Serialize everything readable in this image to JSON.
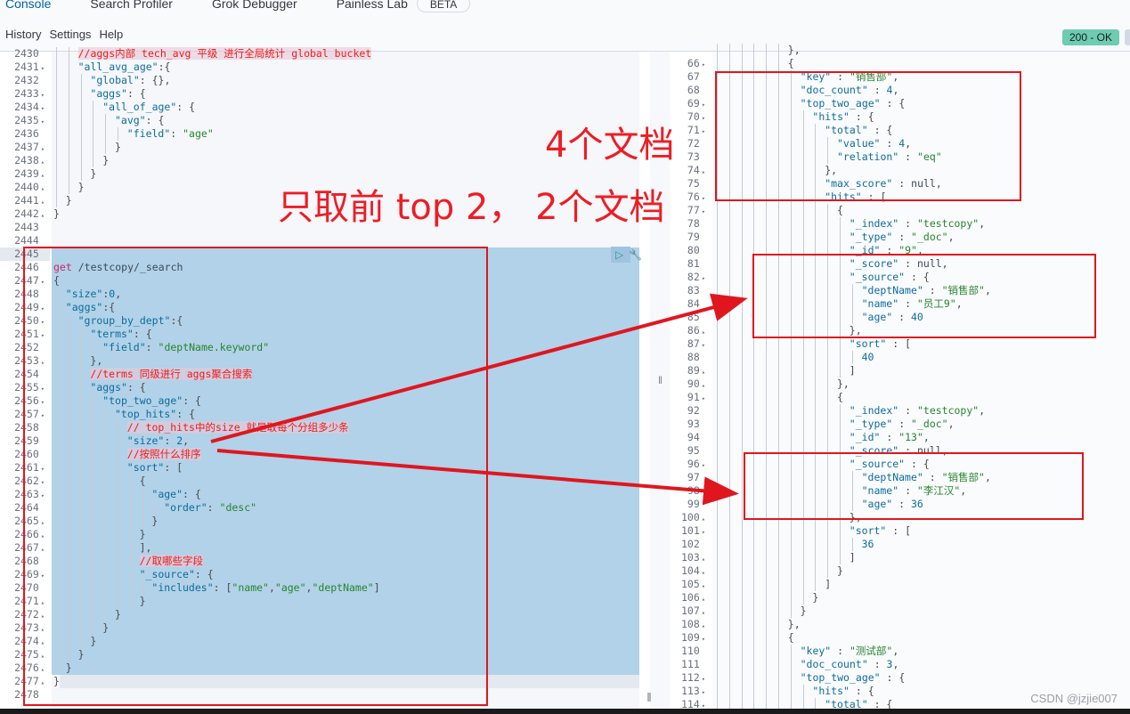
{
  "tabs": [
    {
      "label": "Console",
      "active": true
    },
    {
      "label": "Search Profiler",
      "active": false
    },
    {
      "label": "Grok Debugger",
      "active": false
    },
    {
      "label": "Painless Lab",
      "active": false
    }
  ],
  "tabs_badge": "BETA",
  "menu": {
    "history": "History",
    "settings": "Settings",
    "help": "Help"
  },
  "status": {
    "label": "200 - OK",
    "color": "#6dccb1"
  },
  "request_editor": {
    "lines": [
      {
        "n": "2430",
        "fold": "",
        "indent": 2,
        "html": "<span class='c'>//aggs内部 tech_avg 平级 进行全局统计 global bucket</span>"
      },
      {
        "n": "2431",
        "fold": "▾",
        "indent": 2,
        "html": "<span class='k'>\"all_avg_age\"</span><span class='p'>:{</span>"
      },
      {
        "n": "2432",
        "fold": "",
        "indent": 3,
        "html": "<span class='k'>\"global\"</span><span class='p'>: {},</span>"
      },
      {
        "n": "2433",
        "fold": "▾",
        "indent": 3,
        "html": "<span class='k'>\"aggs\"</span><span class='p'>: {</span>"
      },
      {
        "n": "2434",
        "fold": "▾",
        "indent": 4,
        "html": "<span class='k'>\"all_of_age\"</span><span class='p'>: {</span>"
      },
      {
        "n": "2435",
        "fold": "▾",
        "indent": 5,
        "html": "<span class='k'>\"avg\"</span><span class='p'>: {</span>"
      },
      {
        "n": "2436",
        "fold": "",
        "indent": 6,
        "html": "<span class='k'>\"field\"</span><span class='p'>: </span><span class='s'>\"age\"</span>"
      },
      {
        "n": "2437",
        "fold": "▴",
        "indent": 5,
        "html": "<span class='p'>}</span>"
      },
      {
        "n": "2438",
        "fold": "▴",
        "indent": 4,
        "html": "<span class='p'>}</span>"
      },
      {
        "n": "2439",
        "fold": "▴",
        "indent": 3,
        "html": "<span class='p'>}</span>"
      },
      {
        "n": "2440",
        "fold": "▴",
        "indent": 2,
        "html": "<span class='p'>}</span>"
      },
      {
        "n": "2441",
        "fold": "▴",
        "indent": 1,
        "html": "<span class='p'>}</span>"
      },
      {
        "n": "2442",
        "fold": "▴",
        "indent": 0,
        "html": "<span class='p'>}</span>"
      },
      {
        "n": "2443",
        "fold": "",
        "indent": 0,
        "html": ""
      },
      {
        "n": "2444",
        "fold": "",
        "indent": 0,
        "html": ""
      },
      {
        "n": "2445",
        "fold": "",
        "indent": 0,
        "html": ""
      },
      {
        "n": "2446",
        "fold": "",
        "indent": 0,
        "html": "<span class='kw'>get</span> <span class='url'>/testcopy/_search</span>"
      },
      {
        "n": "2447",
        "fold": "▾",
        "indent": 0,
        "html": "<span class='p'>{</span>"
      },
      {
        "n": "2448",
        "fold": "",
        "indent": 1,
        "html": "<span class='k'>\"size\"</span><span class='p'>:</span><span class='n'>0</span><span class='p'>,</span>"
      },
      {
        "n": "2449",
        "fold": "▾",
        "indent": 1,
        "html": "<span class='k'>\"aggs\"</span><span class='p'>:{</span>"
      },
      {
        "n": "2450",
        "fold": "▾",
        "indent": 2,
        "html": "<span class='k'>\"group_by_dept\"</span><span class='p'>:{</span>"
      },
      {
        "n": "2451",
        "fold": "▾",
        "indent": 3,
        "html": "<span class='k'>\"terms\"</span><span class='p'>: {</span>"
      },
      {
        "n": "2452",
        "fold": "",
        "indent": 4,
        "html": "<span class='k'>\"field\"</span><span class='p'>: </span><span class='s'>\"deptName.keyword\"</span>"
      },
      {
        "n": "2453",
        "fold": "▴",
        "indent": 3,
        "html": "<span class='p'>},</span>"
      },
      {
        "n": "2454",
        "fold": "",
        "indent": 3,
        "html": "<span class='c'>//terms 同级进行 aggs聚合搜索</span>"
      },
      {
        "n": "2455",
        "fold": "▾",
        "indent": 3,
        "html": "<span class='k'>\"aggs\"</span><span class='p'>: {</span>"
      },
      {
        "n": "2456",
        "fold": "▾",
        "indent": 4,
        "html": "<span class='k'>\"top_two_age\"</span><span class='p'>: {</span>"
      },
      {
        "n": "2457",
        "fold": "▾",
        "indent": 5,
        "html": "<span class='k'>\"top_hits\"</span><span class='p'>: {</span>"
      },
      {
        "n": "2458",
        "fold": "",
        "indent": 6,
        "html": "<span class='c'>// top_hits中的size 就是取每个分组多少条</span>"
      },
      {
        "n": "2459",
        "fold": "",
        "indent": 6,
        "html": "<span class='k'>\"size\"</span><span class='p'>: </span><span class='n'>2</span><span class='p'>,</span>"
      },
      {
        "n": "2460",
        "fold": "",
        "indent": 6,
        "html": "<span class='c'>//按照什么排序</span>"
      },
      {
        "n": "2461",
        "fold": "▾",
        "indent": 6,
        "html": "<span class='k'>\"sort\"</span><span class='p'>: [</span>"
      },
      {
        "n": "2462",
        "fold": "▾",
        "indent": 7,
        "html": "<span class='p'>{</span>"
      },
      {
        "n": "2463",
        "fold": "▾",
        "indent": 8,
        "html": "<span class='k'>\"age\"</span><span class='p'>: {</span>"
      },
      {
        "n": "2464",
        "fold": "",
        "indent": 9,
        "html": "<span class='k'>\"order\"</span><span class='p'>: </span><span class='s'>\"desc\"</span>"
      },
      {
        "n": "2465",
        "fold": "▴",
        "indent": 8,
        "html": "<span class='p'>}</span>"
      },
      {
        "n": "2466",
        "fold": "▴",
        "indent": 7,
        "html": "<span class='p'>}</span>"
      },
      {
        "n": "2467",
        "fold": "▴",
        "indent": 7,
        "html": "<span class='p'>],</span>"
      },
      {
        "n": "2468",
        "fold": "",
        "indent": 7,
        "html": "<span class='c'>//取哪些字段</span>"
      },
      {
        "n": "2469",
        "fold": "▾",
        "indent": 7,
        "html": "<span class='k'>\"_source\"</span><span class='p'>: {</span>"
      },
      {
        "n": "2470",
        "fold": "",
        "indent": 8,
        "html": "<span class='k'>\"includes\"</span><span class='p'>: [</span><span class='s'>\"name\"</span><span class='p'>,</span><span class='s'>\"age\"</span><span class='p'>,</span><span class='s'>\"deptName\"</span><span class='p'>]</span>"
      },
      {
        "n": "2471",
        "fold": "▴",
        "indent": 7,
        "html": "<span class='p'>}</span>"
      },
      {
        "n": "2472",
        "fold": "▴",
        "indent": 5,
        "html": "<span class='p'>}</span>"
      },
      {
        "n": "2473",
        "fold": "▴",
        "indent": 4,
        "html": "<span class='p'>}</span>"
      },
      {
        "n": "2474",
        "fold": "▴",
        "indent": 3,
        "html": "<span class='p'>}</span>"
      },
      {
        "n": "2475",
        "fold": "▴",
        "indent": 2,
        "html": "<span class='p'>}</span>"
      },
      {
        "n": "2476",
        "fold": "▴",
        "indent": 1,
        "html": "<span class='p'>}</span>"
      },
      {
        "n": "2477",
        "fold": "▴",
        "indent": 0,
        "html": "<span class='p'>}</span>"
      },
      {
        "n": "2478",
        "fold": "",
        "indent": 0,
        "html": ""
      }
    ]
  },
  "response_editor": {
    "lines": [
      {
        "n": "",
        "fold": "",
        "indent": 6,
        "html": "<span class='p'>},</span>"
      },
      {
        "n": "66",
        "fold": "▾",
        "indent": 6,
        "html": "<span class='p'>{</span>"
      },
      {
        "n": "67",
        "fold": "",
        "indent": 7,
        "html": "<span class='k'>\"key\"</span><span class='p'> : </span><span class='s'>\"销售部\"</span><span class='p'>,</span>"
      },
      {
        "n": "68",
        "fold": "",
        "indent": 7,
        "html": "<span class='k'>\"doc_count\"</span><span class='p'> : </span><span class='n'>4</span><span class='p'>,</span>"
      },
      {
        "n": "69",
        "fold": "▾",
        "indent": 7,
        "html": "<span class='k'>\"top_two_age\"</span><span class='p'> : {</span>"
      },
      {
        "n": "70",
        "fold": "▾",
        "indent": 8,
        "html": "<span class='k'>\"hits\"</span><span class='p'> : {</span>"
      },
      {
        "n": "71",
        "fold": "▾",
        "indent": 9,
        "html": "<span class='k'>\"total\"</span><span class='p'> : {</span>"
      },
      {
        "n": "72",
        "fold": "",
        "indent": 10,
        "html": "<span class='k'>\"value\"</span><span class='p'> : </span><span class='n'>4</span><span class='p'>,</span>"
      },
      {
        "n": "73",
        "fold": "",
        "indent": 10,
        "html": "<span class='k'>\"relation\"</span><span class='p'> : </span><span class='s'>\"eq\"</span>"
      },
      {
        "n": "74",
        "fold": "▴",
        "indent": 9,
        "html": "<span class='p'>},</span>"
      },
      {
        "n": "75",
        "fold": "",
        "indent": 9,
        "html": "<span class='k'>\"max_score\"</span><span class='p'> : </span><span class='nul'>null</span><span class='p'>,</span>"
      },
      {
        "n": "76",
        "fold": "▾",
        "indent": 9,
        "html": "<span class='k'>\"hits\"</span><span class='p'> : [</span>"
      },
      {
        "n": "77",
        "fold": "▾",
        "indent": 10,
        "html": "<span class='p'>{</span>"
      },
      {
        "n": "78",
        "fold": "",
        "indent": 11,
        "html": "<span class='k'>\"_index\"</span><span class='p'> : </span><span class='s'>\"testcopy\"</span><span class='p'>,</span>"
      },
      {
        "n": "79",
        "fold": "",
        "indent": 11,
        "html": "<span class='k'>\"_type\"</span><span class='p'> : </span><span class='s'>\"_doc\"</span><span class='p'>,</span>"
      },
      {
        "n": "80",
        "fold": "",
        "indent": 11,
        "html": "<span class='k'>\"_id\"</span><span class='p'> : </span><span class='s'>\"9\"</span><span class='p'>,</span>"
      },
      {
        "n": "81",
        "fold": "",
        "indent": 11,
        "html": "<span class='k'>\"_score\"</span><span class='p'> : </span><span class='nul'>null</span><span class='p'>,</span>"
      },
      {
        "n": "82",
        "fold": "▾",
        "indent": 11,
        "html": "<span class='k'>\"_source\"</span><span class='p'> : {</span>"
      },
      {
        "n": "83",
        "fold": "",
        "indent": 12,
        "html": "<span class='k'>\"deptName\"</span><span class='p'> : </span><span class='s'>\"销售部\"</span><span class='p'>,</span>"
      },
      {
        "n": "84",
        "fold": "",
        "indent": 12,
        "html": "<span class='k'>\"name\"</span><span class='p'> : </span><span class='s'>\"员工9\"</span><span class='p'>,</span>"
      },
      {
        "n": "85",
        "fold": "",
        "indent": 12,
        "html": "<span class='k'>\"age\"</span><span class='p'> : </span><span class='n'>40</span>"
      },
      {
        "n": "86",
        "fold": "▴",
        "indent": 11,
        "html": "<span class='p'>},</span>"
      },
      {
        "n": "87",
        "fold": "▾",
        "indent": 11,
        "html": "<span class='k'>\"sort\"</span><span class='p'> : [</span>"
      },
      {
        "n": "88",
        "fold": "",
        "indent": 12,
        "html": "<span class='n'>40</span>"
      },
      {
        "n": "89",
        "fold": "▴",
        "indent": 11,
        "html": "<span class='p'>]</span>"
      },
      {
        "n": "90",
        "fold": "▴",
        "indent": 10,
        "html": "<span class='p'>},</span>"
      },
      {
        "n": "91",
        "fold": "▾",
        "indent": 10,
        "html": "<span class='p'>{</span>"
      },
      {
        "n": "92",
        "fold": "",
        "indent": 11,
        "html": "<span class='k'>\"_index\"</span><span class='p'> : </span><span class='s'>\"testcopy\"</span><span class='p'>,</span>"
      },
      {
        "n": "93",
        "fold": "",
        "indent": 11,
        "html": "<span class='k'>\"_type\"</span><span class='p'> : </span><span class='s'>\"_doc\"</span><span class='p'>,</span>"
      },
      {
        "n": "94",
        "fold": "",
        "indent": 11,
        "html": "<span class='k'>\"_id\"</span><span class='p'> : </span><span class='s'>\"13\"</span><span class='p'>,</span>"
      },
      {
        "n": "95",
        "fold": "",
        "indent": 11,
        "html": "<span class='k'>\"_score\"</span><span class='p'> : </span><span class='nul'>null</span><span class='p'>,</span>"
      },
      {
        "n": "96",
        "fold": "▾",
        "indent": 11,
        "html": "<span class='k'>\"_source\"</span><span class='p'> : {</span>"
      },
      {
        "n": "97",
        "fold": "",
        "indent": 12,
        "html": "<span class='k'>\"deptName\"</span><span class='p'> : </span><span class='s'>\"销售部\"</span><span class='p'>,</span>"
      },
      {
        "n": "98",
        "fold": "",
        "indent": 12,
        "html": "<span class='k'>\"name\"</span><span class='p'> : </span><span class='s'>\"李江汉\"</span><span class='p'>,</span>"
      },
      {
        "n": "99",
        "fold": "",
        "indent": 12,
        "html": "<span class='k'>\"age\"</span><span class='p'> : </span><span class='n'>36</span>"
      },
      {
        "n": "100",
        "fold": "▴",
        "indent": 11,
        "html": "<span class='p'>},</span>"
      },
      {
        "n": "101",
        "fold": "▾",
        "indent": 11,
        "html": "<span class='k'>\"sort\"</span><span class='p'> : [</span>"
      },
      {
        "n": "102",
        "fold": "",
        "indent": 12,
        "html": "<span class='n'>36</span>"
      },
      {
        "n": "103",
        "fold": "▴",
        "indent": 11,
        "html": "<span class='p'>]</span>"
      },
      {
        "n": "104",
        "fold": "▴",
        "indent": 10,
        "html": "<span class='p'>}</span>"
      },
      {
        "n": "105",
        "fold": "▴",
        "indent": 9,
        "html": "<span class='p'>]</span>"
      },
      {
        "n": "106",
        "fold": "▴",
        "indent": 8,
        "html": "<span class='p'>}</span>"
      },
      {
        "n": "107",
        "fold": "▴",
        "indent": 7,
        "html": "<span class='p'>}</span>"
      },
      {
        "n": "108",
        "fold": "▴",
        "indent": 6,
        "html": "<span class='p'>},</span>"
      },
      {
        "n": "109",
        "fold": "▾",
        "indent": 6,
        "html": "<span class='p'>{</span>"
      },
      {
        "n": "110",
        "fold": "",
        "indent": 7,
        "html": "<span class='k'>\"key\"</span><span class='p'> : </span><span class='s'>\"测试部\"</span><span class='p'>,</span>"
      },
      {
        "n": "111",
        "fold": "",
        "indent": 7,
        "html": "<span class='k'>\"doc_count\"</span><span class='p'> : </span><span class='n'>3</span><span class='p'>,</span>"
      },
      {
        "n": "112",
        "fold": "▾",
        "indent": 7,
        "html": "<span class='k'>\"top_two_age\"</span><span class='p'> : {</span>"
      },
      {
        "n": "113",
        "fold": "▾",
        "indent": 8,
        "html": "<span class='k'>\"hits\"</span><span class='p'> : {</span>"
      },
      {
        "n": "114",
        "fold": "▾",
        "indent": 9,
        "html": "<span class='k'>\"total\"</span><span class='p'> : {</span>"
      }
    ]
  },
  "annotations": {
    "four_docs": "4个文档",
    "top_two": "只取前 top 2， 2个文档"
  },
  "watermark": "CSDN @jzjie007"
}
